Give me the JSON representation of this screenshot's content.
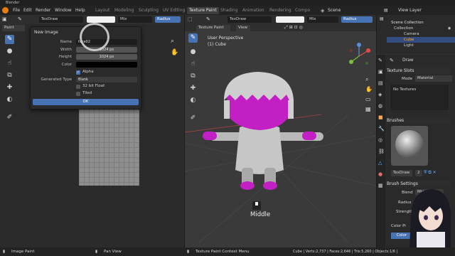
{
  "window": {
    "title": "Blender"
  },
  "menu": {
    "items": [
      "File",
      "Edit",
      "Render",
      "Window",
      "Help"
    ]
  },
  "workspaces": [
    "Layout",
    "Modeling",
    "Sculpting",
    "UV Editing",
    "Texture Paint",
    "Shading",
    "Animation",
    "Rendering",
    "Compo"
  ],
  "workspace_active_index": 4,
  "topright": {
    "scene": "Scene",
    "view_layer": "View Layer"
  },
  "image_editor": {
    "mode": "Paint",
    "brush": "TexDraw",
    "blend": "Mix",
    "radius_label": "Radius",
    "dialog": {
      "title": "New Image",
      "name_label": "Name",
      "name_value": "face02",
      "width_label": "Width",
      "width_value": "1024 px",
      "height_label": "Height",
      "height_value": "1024 px",
      "color_label": "Color",
      "alpha_label": "Alpha",
      "generated_type_label": "Generated Type",
      "generated_type_value": "Blank",
      "float_label": "32 bit Float",
      "tiled_label": "Tiled",
      "ok_label": "OK"
    }
  },
  "viewport": {
    "mode": "Texture Paint",
    "brush": "TexDraw",
    "blend": "Mix",
    "radius_label": "Radius",
    "view_label": "View",
    "perspective_text": "User Perspective",
    "object_text": "(1) Cube",
    "key_text": "Middle"
  },
  "outliner": {
    "title": "Scene Collection",
    "items": [
      "Collection",
      "Camera",
      "Cube",
      "Light"
    ],
    "selected_index": 2
  },
  "properties": {
    "tool_name": "Draw",
    "texture_slots": "Texture Slots",
    "mode_label": "Mode",
    "mode_value": "Material",
    "no_textures": "No Textures",
    "brushes": "Brushes",
    "brush_name": "TexDraw",
    "brush_users": "2",
    "brush_settings": "Brush Settings",
    "blend_label": "Blend",
    "blend_value": "Mix",
    "radius_label": "Radius",
    "strength_label": "Strength",
    "color_picker": "Color Pi",
    "color_tab": "Color"
  },
  "status": {
    "left": "Image Paint",
    "mid1": "Pan View",
    "mid2": "Texture Paint Context Menu",
    "right": "Cube | Verts:2,737 | Faces:2,646 | Tris:5,260 | Objects:1/6 |"
  },
  "colors": {
    "accent": "#4772b3",
    "magenta": "#c21fc4",
    "brand": "#e87d0d"
  }
}
